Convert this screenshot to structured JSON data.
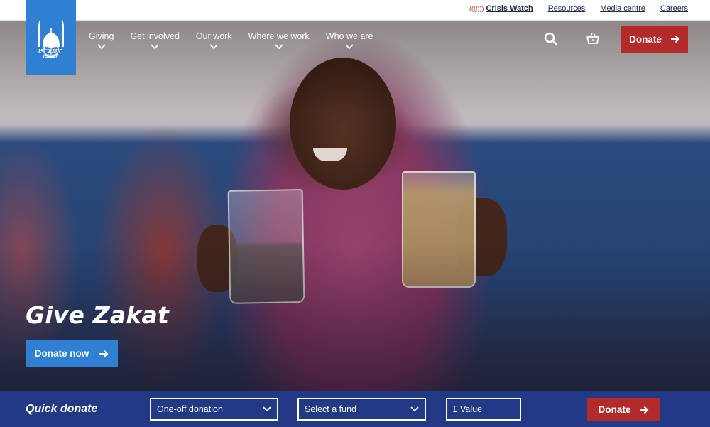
{
  "utility": {
    "crisis_icon": "(((!)))",
    "crisis_label": "Crisis Watch",
    "links": [
      "Resources",
      "Media centre",
      "Careers"
    ]
  },
  "logo": {
    "name": "ISLAMIC",
    "sub": "RELIEF"
  },
  "nav": {
    "items": [
      {
        "label": "Giving"
      },
      {
        "label": "Get involved"
      },
      {
        "label": "Our work"
      },
      {
        "label": "Where we work"
      },
      {
        "label": "Who we are"
      }
    ],
    "donate_label": "Donate"
  },
  "hero": {
    "title": "Give Zakat",
    "cta_label": "Donate now"
  },
  "quick_donate": {
    "label": "Quick donate",
    "type_value": "One-off donation",
    "fund_value": "Select a fund",
    "currency_symbol": "£",
    "value_placeholder": "Value",
    "donate_label": "Donate"
  },
  "colors": {
    "brand_blue": "#2f7fd3",
    "donate_red": "#b22a2a",
    "quick_bar_blue": "#223a86"
  }
}
